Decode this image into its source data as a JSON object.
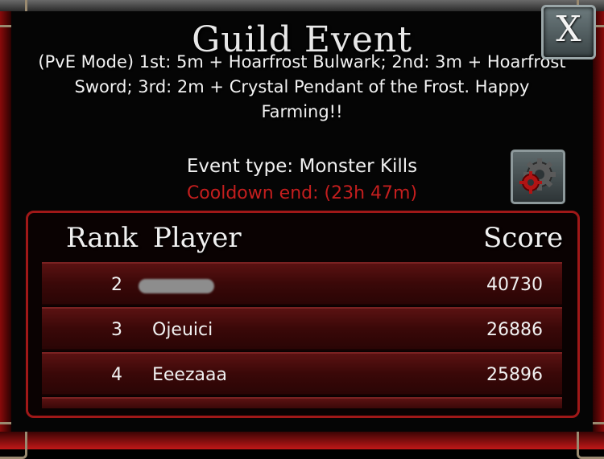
{
  "dialog": {
    "title": "Guild Event",
    "description": "(PvE Mode) 1st: 5m + Hoarfrost Bulwark; 2nd: 3m + Hoarfrost Sword; 3rd: 2m + Crystal Pendant of the Frost. Happy Farming!!",
    "event_type": "Event type: Monster Kills",
    "cooldown": "Cooldown end:  (23h 47m)",
    "close_label": "X"
  },
  "table": {
    "headers": {
      "rank": "Rank",
      "player": "Player",
      "score": "Score"
    },
    "rows": [
      {
        "rank": "2",
        "player": "",
        "player_obscured": true,
        "score": "40730"
      },
      {
        "rank": "3",
        "player": "Ojeuici",
        "score": "26886"
      },
      {
        "rank": "4",
        "player": "Eeezaaa",
        "score": "25896"
      }
    ]
  },
  "icons": {
    "close": "close-icon",
    "settings": "gear-icon"
  },
  "colors": {
    "cooldown": "#c41e1e",
    "accent": "#a01818",
    "row": "#4a0e0e"
  }
}
